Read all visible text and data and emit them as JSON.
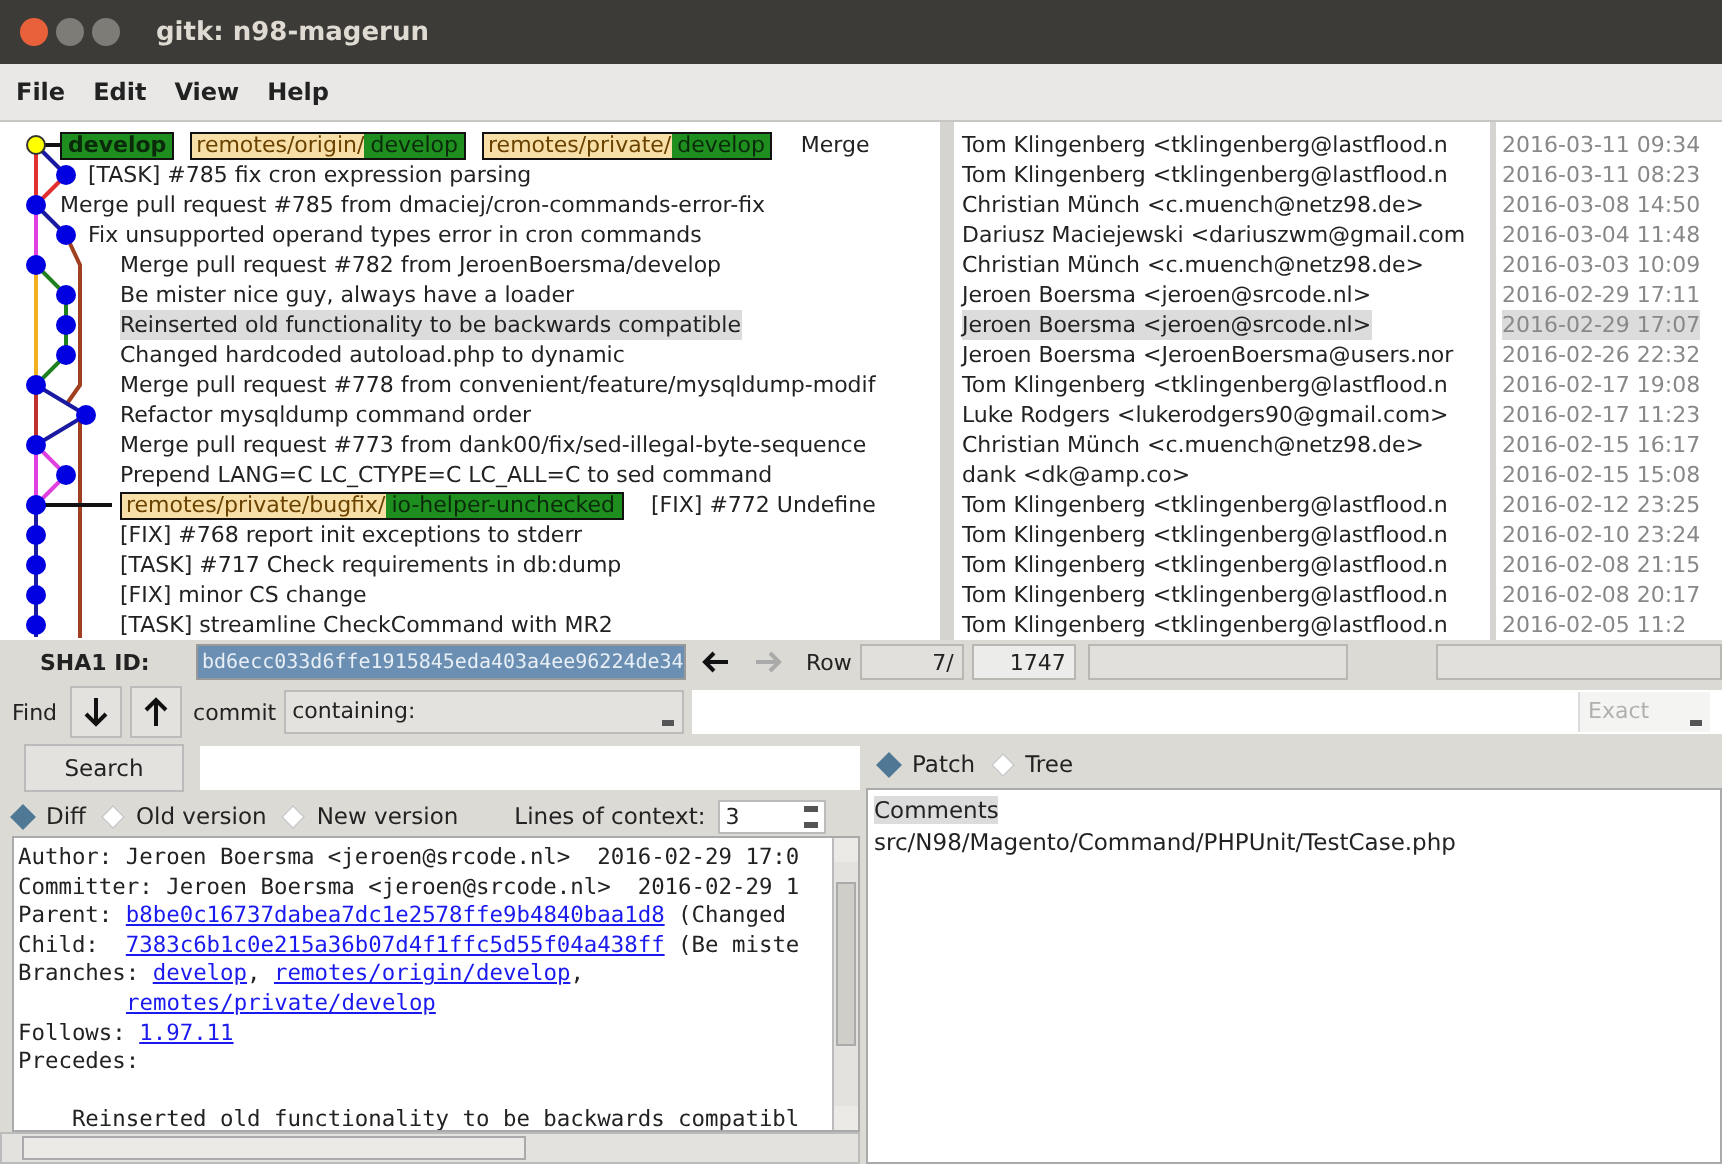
{
  "window": {
    "title": "gitk: n98-magerun"
  },
  "menu": [
    "File",
    "Edit",
    "View",
    "Help"
  ],
  "commits": [
    {
      "subject": "Merge",
      "author": "Tom Klingenberg <tklingenberg@lastflood.n",
      "date": "2016-03-11 09:34",
      "selected": false,
      "head": true,
      "refs": [
        {
          "kind": "local",
          "name": "develop"
        },
        {
          "kind": "remote",
          "prefix": "remotes/origin/",
          "name": "develop"
        },
        {
          "kind": "remote",
          "prefix": "remotes/private/",
          "name": "develop"
        }
      ]
    },
    {
      "subject": "[TASK] #785 fix cron expression parsing",
      "author": "Tom Klingenberg <tklingenberg@lastflood.n",
      "date": "2016-03-11 08:23",
      "selected": false,
      "head": false
    },
    {
      "subject": "Merge pull request #785 from dmaciej/cron-commands-error-fix",
      "author": "Christian Münch <c.muench@netz98.de>",
      "date": "2016-03-08 14:50",
      "selected": false,
      "head": false
    },
    {
      "subject": "Fix unsupported operand types error in cron commands",
      "author": "Dariusz Maciejewski <dariuszwm@gmail.com",
      "date": "2016-03-04 11:48",
      "selected": false,
      "head": false
    },
    {
      "subject": "Merge pull request #782 from JeroenBoersma/develop",
      "author": "Christian Münch <c.muench@netz98.de>",
      "date": "2016-03-03 10:09",
      "selected": false,
      "head": false
    },
    {
      "subject": "Be mister nice guy, always have a loader",
      "author": "Jeroen Boersma <jeroen@srcode.nl>",
      "date": "2016-02-29 17:11",
      "selected": false,
      "head": false
    },
    {
      "subject": "Reinserted old functionality to be backwards compatible",
      "author": "Jeroen Boersma <jeroen@srcode.nl>",
      "date": "2016-02-29 17:07",
      "selected": true,
      "head": false
    },
    {
      "subject": "Changed hardcoded autoload.php to dynamic",
      "author": "Jeroen Boersma <JeroenBoersma@users.nor",
      "date": "2016-02-26 22:32",
      "selected": false,
      "head": false
    },
    {
      "subject": "Merge pull request #778 from convenient/feature/mysqldump-modif",
      "author": "Tom Klingenberg <tklingenberg@lastflood.n",
      "date": "2016-02-17 19:08",
      "selected": false,
      "head": false
    },
    {
      "subject": "Refactor mysqldump command order",
      "author": "Luke Rodgers <lukerodgers90@gmail.com>",
      "date": "2016-02-17 11:23",
      "selected": false,
      "head": false
    },
    {
      "subject": "Merge pull request #773 from dank00/fix/sed-illegal-byte-sequence",
      "author": "Christian Münch <c.muench@netz98.de>",
      "date": "2016-02-15 16:17",
      "selected": false,
      "head": false
    },
    {
      "subject": "Prepend LANG=C LC_CTYPE=C LC_ALL=C to sed command",
      "author": "dank <dk@amp.co>",
      "date": "2016-02-15 15:08",
      "selected": false,
      "head": false
    },
    {
      "subject": "[FIX] #772 Undefine",
      "author": "Tom Klingenberg <tklingenberg@lastflood.n",
      "date": "2016-02-12 23:25",
      "selected": false,
      "head": false,
      "refs": [
        {
          "kind": "remote",
          "prefix": "remotes/private/bugfix/",
          "name": "io-helper-unchecked"
        }
      ]
    },
    {
      "subject": "[FIX] #768 report init exceptions to stderr",
      "author": "Tom Klingenberg <tklingenberg@lastflood.n",
      "date": "2016-02-10 23:24",
      "selected": false,
      "head": false
    },
    {
      "subject": "[TASK] #717 Check requirements in db:dump",
      "author": "Tom Klingenberg <tklingenberg@lastflood.n",
      "date": "2016-02-08 21:15",
      "selected": false,
      "head": false
    },
    {
      "subject": "[FIX] minor CS change",
      "author": "Tom Klingenberg <tklingenberg@lastflood.n",
      "date": "2016-02-08 20:17",
      "selected": false,
      "head": false
    },
    {
      "subject": "[TASK] streamline CheckCommand with MR2",
      "author": "Tom Klingenberg <tklingenberg@lastflood.n",
      "date": "2016-02-05 11:2",
      "selected": false,
      "head": false
    }
  ],
  "sha1": {
    "label": "SHA1 ID:",
    "value": "bd6ecc033d6ffe1915845eda403a4ee96224de34",
    "highlighted": true
  },
  "back_button": {
    "disabled": false
  },
  "forward_button": {
    "disabled": true
  },
  "row": {
    "label": "Row",
    "current": "7/",
    "total": "1747"
  },
  "find": {
    "label": "Find",
    "type": "commit",
    "mode": "containing:",
    "match": "Exact",
    "match_disabled": true
  },
  "search_button": "Search",
  "diff_view": {
    "options": [
      {
        "label": "Diff",
        "selected": true
      },
      {
        "label": "Old version",
        "selected": false
      },
      {
        "label": "New version",
        "selected": false
      }
    ],
    "context_label": "Lines of context:",
    "context": "3"
  },
  "details": [
    {
      "kind": "text",
      "segments": [
        {
          "text": "Author: Jeroen Boersma <jeroen@srcode.nl>  2016-02-29 17:0",
          "link": false
        }
      ]
    },
    {
      "kind": "text",
      "segments": [
        {
          "text": "Committer: Jeroen Boersma <jeroen@srcode.nl>  2016-02-29 1",
          "link": false
        }
      ]
    },
    {
      "kind": "text",
      "segments": [
        {
          "text": "Parent: ",
          "link": false
        },
        {
          "text": "b8be0c16737dabea7dc1e2578ffe9b4840baa1d8",
          "link": true
        },
        {
          "text": " (Changed",
          "link": false
        }
      ]
    },
    {
      "kind": "text",
      "segments": [
        {
          "text": "Child:  ",
          "link": false
        },
        {
          "text": "7383c6b1c0e215a36b07d4f1ffc5d55f04a438ff",
          "link": true
        },
        {
          "text": " (Be miste",
          "link": false
        }
      ]
    },
    {
      "kind": "text",
      "segments": [
        {
          "text": "Branches: ",
          "link": false
        },
        {
          "text": "develop",
          "link": true
        },
        {
          "text": ", ",
          "link": false
        },
        {
          "text": "remotes/origin/develop",
          "link": true
        },
        {
          "text": ",",
          "link": false
        }
      ]
    },
    {
      "kind": "indent",
      "segments": [
        {
          "text": "remotes/private/develop",
          "link": true
        }
      ]
    },
    {
      "kind": "text",
      "segments": [
        {
          "text": "Follows: ",
          "link": false
        },
        {
          "text": "1.97.11",
          "link": true
        }
      ]
    },
    {
      "kind": "text",
      "segments": [
        {
          "text": "Precedes:",
          "link": false
        }
      ]
    },
    {
      "kind": "blank"
    },
    {
      "kind": "text",
      "segments": [
        {
          "text": "    Reinserted old functionality to be backwards compatibl",
          "link": false
        }
      ]
    }
  ],
  "file_view": {
    "options": [
      {
        "label": "Patch",
        "selected": true
      },
      {
        "label": "Tree",
        "selected": false
      }
    ]
  },
  "files": [
    {
      "name": "Comments",
      "selected": true
    },
    {
      "name": "src/N98/Magento/Command/PHPUnit/TestCase.php",
      "selected": false
    }
  ]
}
